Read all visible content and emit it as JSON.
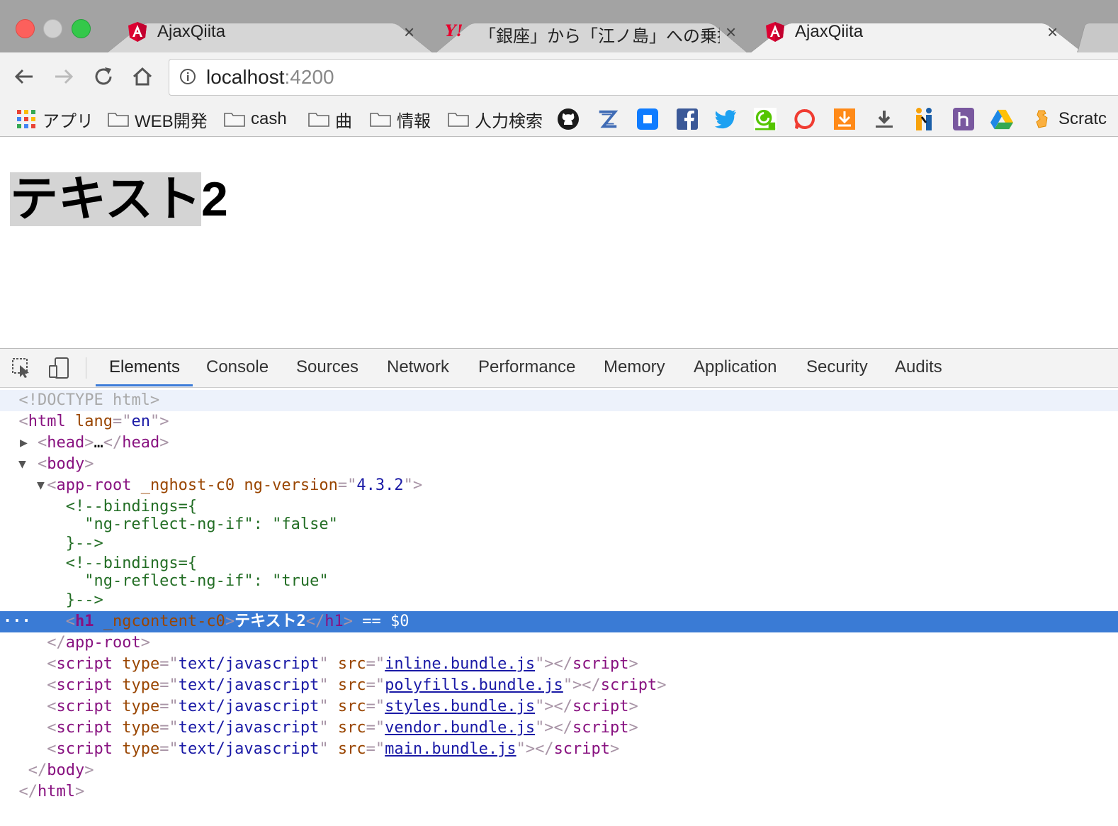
{
  "tabs": [
    {
      "title": "AjaxQiita",
      "favicon": "angular-icon",
      "active": false
    },
    {
      "title": "「銀座」から「江ノ島」への乗換案",
      "favicon": "yahoo-icon",
      "active": false,
      "favicon_text": "Y!"
    },
    {
      "title": "AjaxQiita",
      "favicon": "angular-icon",
      "active": true
    }
  ],
  "tab_close": "×",
  "address": {
    "host": "localhost",
    "port": ":4200"
  },
  "bookmarks": [
    {
      "label": "アプリ",
      "icon": "apps-grid-icon"
    },
    {
      "label": "WEB開発",
      "icon": "folder-icon"
    },
    {
      "label": "cash",
      "icon": "folder-icon"
    },
    {
      "label": "曲",
      "icon": "folder-icon"
    },
    {
      "label": "情報",
      "icon": "folder-icon"
    },
    {
      "label": "人力検索",
      "icon": "folder-icon"
    },
    {
      "label": "Scratc",
      "icon": "scratch-icon"
    }
  ],
  "bookmark_icons": [
    "github-icon",
    "zenhub-icon",
    "stop-icon",
    "facebook-icon",
    "twitter-icon",
    "qiita-icon",
    "chat-icon",
    "download-orange-icon",
    "download-icon",
    "people-icon",
    "heroku-icon",
    "drive-icon"
  ],
  "page": {
    "h1_highlight": "テキスト",
    "h1_rest": "2"
  },
  "devtools": {
    "tabs": [
      "Elements",
      "Console",
      "Sources",
      "Network",
      "Performance",
      "Memory",
      "Application",
      "Security",
      "Audits"
    ],
    "selected_tab": "Elements",
    "dom": {
      "doctype": "<!DOCTYPE html>",
      "html_tag": "html",
      "lang_attr": "lang",
      "lang_val": "en",
      "head_tag": "head",
      "ellipsis": "…",
      "body_tag": "body",
      "approot_tag": "app-root",
      "approot_attr1": "_nghost-c0",
      "approot_attr2": "ng-version",
      "approot_ver": "4.3.2",
      "comment1_open": "<!--bindings={",
      "comment1_body": "  \"ng-reflect-ng-if\": \"false\"",
      "comment_close": "}-->",
      "comment2_open": "<!--bindings={",
      "comment2_body": "  \"ng-reflect-ng-if\": \"true\"",
      "h1_tag": "h1",
      "h1_attr": "_ngcontent-c0",
      "h1_text": "テキスト2",
      "selected_marker": "== $0",
      "row_dots": "···",
      "script_tag": "script",
      "type_attr": "type",
      "type_val": "text/javascript",
      "src_attr": "src",
      "scripts": [
        "inline.bundle.js",
        "polyfills.bundle.js",
        "styles.bundle.js",
        "vendor.bundle.js",
        "main.bundle.js"
      ]
    }
  }
}
